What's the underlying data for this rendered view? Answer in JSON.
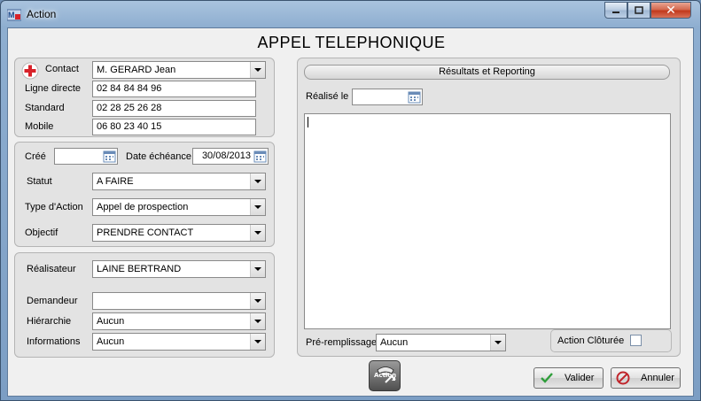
{
  "window": {
    "title": "Action"
  },
  "page_title": "APPEL TELEPHONIQUE",
  "contact_panel": {
    "contact_label": "Contact",
    "contact_value": "M. GERARD Jean",
    "ligne_directe_label": "Ligne directe",
    "ligne_directe_value": "02 84 84 84 96",
    "standard_label": "Standard",
    "standard_value": "02 28 25 26 28",
    "mobile_label": "Mobile",
    "mobile_value": "06 80 23 40 15"
  },
  "action_panel": {
    "cree_label": "Créé",
    "cree_value": "",
    "echeance_label": "Date échéance",
    "echeance_value": "30/08/2013",
    "statut_label": "Statut",
    "statut_value": "A FAIRE",
    "type_label": "Type d'Action",
    "type_value": "Appel de prospection",
    "objectif_label": "Objectif",
    "objectif_value": "PRENDRE CONTACT"
  },
  "people_panel": {
    "realisateur_label": "Réalisateur",
    "realisateur_value": "LAINE BERTRAND",
    "demandeur_label": "Demandeur",
    "demandeur_value": "",
    "hierarchie_label": "Hiérarchie",
    "hierarchie_value": "Aucun",
    "informations_label": "Informations",
    "informations_value": "Aucun"
  },
  "results_panel": {
    "header": "Résultats et Reporting",
    "realise_label": "Réalisé le",
    "realise_value": "",
    "notes_value": "",
    "preremplissage_label": "Pré-remplissage",
    "preremplissage_value": "Aucun",
    "cloturee_label": "Action Clôturée",
    "cloturee_checked": false
  },
  "action_icon_label": "Action",
  "buttons": {
    "valider": "Valider",
    "annuler": "Annuler"
  },
  "colors": {
    "accent_red": "#d8222a",
    "valider_green": "#2e9e3a",
    "annuler_red": "#c0262c"
  }
}
